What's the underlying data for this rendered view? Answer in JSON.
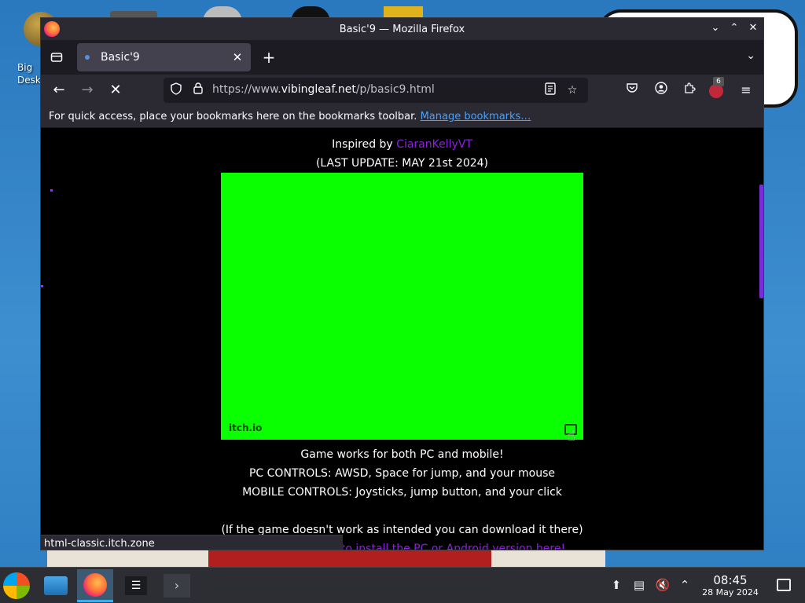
{
  "desktop": {
    "icon_label": "Big Desk"
  },
  "window": {
    "title": "Basic'9 — Mozilla Firefox",
    "controls": {
      "minimize": "⌄",
      "maximize": "⌃",
      "close": "✕"
    }
  },
  "tab": {
    "title": "Basic'9",
    "close": "✕",
    "new_tab": "+",
    "overflow": "⌄"
  },
  "nav": {
    "back": "←",
    "forward": "→",
    "stop": "✕",
    "url_prefix": "https://www.",
    "url_host": "vibingleaf.net",
    "url_path": "/p/basic9.html",
    "extension_badge": "6"
  },
  "bookmarks": {
    "hint": "For quick access, place your bookmarks here on the bookmarks toolbar.",
    "manage_link": "Manage bookmarks…"
  },
  "page": {
    "inspired_prefix": "Inspired by ",
    "inspired_name": "CiaranKellyVT",
    "last_update": "(LAST UPDATE: MAY 21st 2024)",
    "itch_logo": "itch.io",
    "works_line": "Game works for both PC and mobile!",
    "pc_controls": "PC CONTROLS: AWSD, Space for jump, and your mouse",
    "mobile_controls": "MOBILE CONTROLS: Joysticks, jump button, and your click",
    "download_note": "(If the game doesn't work as intended you can download it there)",
    "install_link": "to install the PC or Android version here!",
    "game_bg_color": "#0aff00"
  },
  "status": {
    "link_preview": "html-classic.itch.zone"
  },
  "taskbar": {
    "time": "08:45",
    "date": "28 May 2024"
  },
  "colors": {
    "accent_purple": "#8f1fe0",
    "link_blue": "#45a1ff"
  }
}
